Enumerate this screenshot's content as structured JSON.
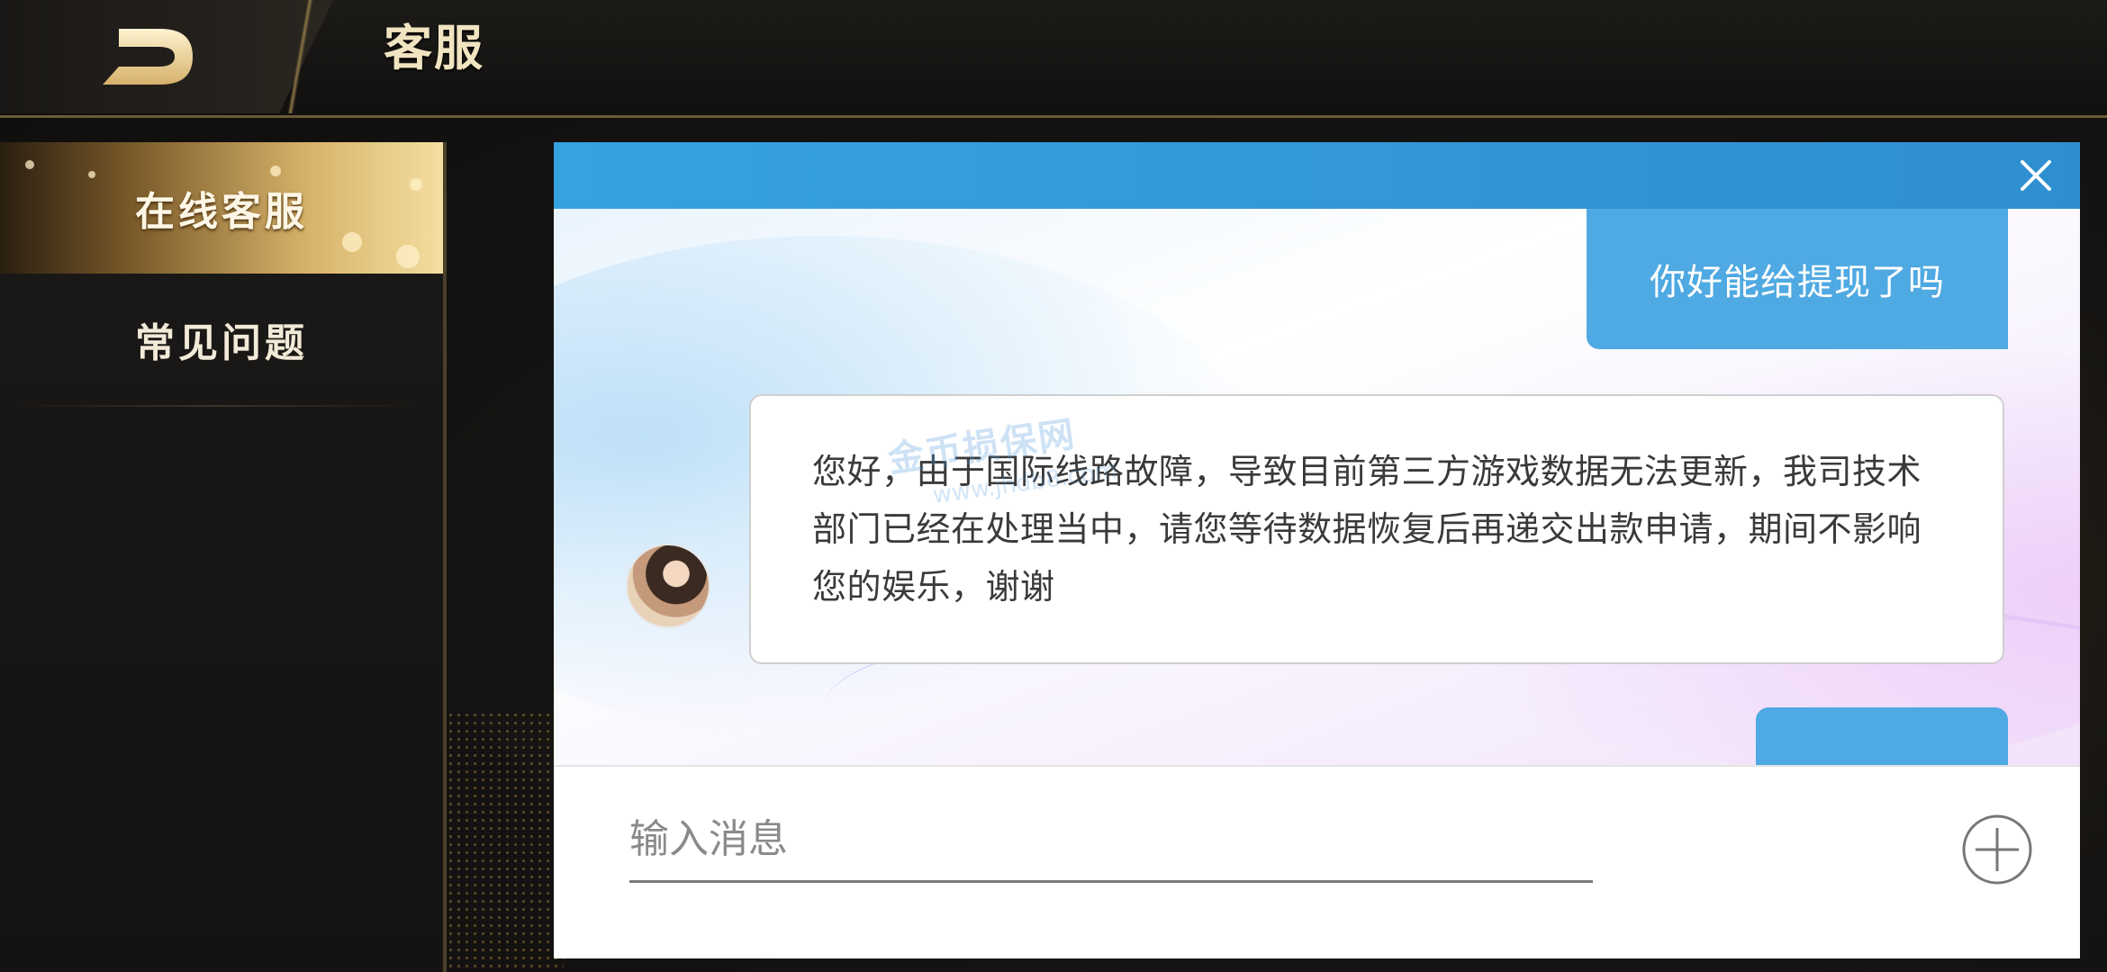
{
  "header": {
    "title": "客服"
  },
  "sidebar": {
    "items": [
      {
        "label": "在线客服",
        "active": true
      },
      {
        "label": "常见问题",
        "active": false
      }
    ]
  },
  "chat": {
    "messages": [
      {
        "from": "user",
        "text": "你好能给提现了吗"
      },
      {
        "from": "agent",
        "text": "您好，由于国际线路故障，导致目前第三方游戏数据无法更新，我司技术部门已经在处理当中，请您等待数据恢复后再递交出款申请，期间不影响您的娱乐，谢谢"
      }
    ],
    "watermark": "金币损保网",
    "watermark_url": "www.jhdb8.com",
    "input_placeholder": "输入消息"
  },
  "colors": {
    "accent_blue": "#36a2e0",
    "bubble_blue": "#4fa9e2",
    "gold": "#d8b46a"
  }
}
